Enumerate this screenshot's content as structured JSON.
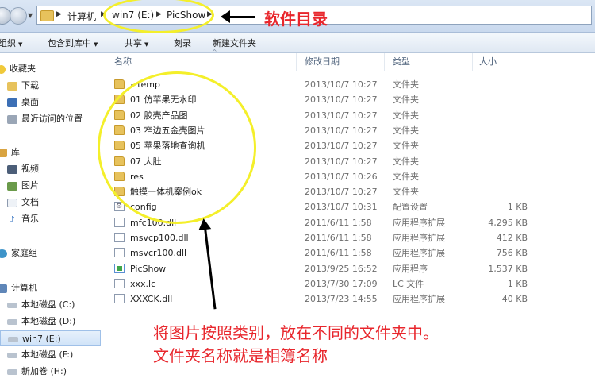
{
  "address": {
    "crumbs": [
      "计算机",
      "win7 (E:)",
      "PicShow"
    ]
  },
  "annotations": {
    "title": "软件目录",
    "note_line1": "将图片按照类别，放在不同的文件夹中。",
    "note_line2": "文件夹名称就是相簿名称",
    "highlight_color": "#f4ef2a",
    "text_color": "#e8262c"
  },
  "toolbar": {
    "organize": "组织",
    "include_in_library": "包含到库中",
    "share": "共享",
    "burn": "刻录",
    "new_folder": "新建文件夹"
  },
  "nav": {
    "favorites": "收藏夹",
    "downloads": "下载",
    "desktop": "桌面",
    "recent": "最近访问的位置",
    "libraries": "库",
    "videos": "视频",
    "pictures": "图片",
    "documents": "文档",
    "music": "音乐",
    "homegroup": "家庭组",
    "computer": "计算机",
    "drive_c": "本地磁盘 (C:)",
    "drive_d": "本地磁盘 (D:)",
    "drive_e": "win7 (E:)",
    "drive_f": "本地磁盘 (F:)",
    "drive_h": "新加卷 (H:)"
  },
  "columns": {
    "name": "名称",
    "modified": "修改日期",
    "type": "类型",
    "size": "大小"
  },
  "files": [
    {
      "name": "~temp",
      "date": "2013/10/7 10:27",
      "type": "文件夹",
      "size": "",
      "icon": "folder"
    },
    {
      "name": "01 仿苹果无水印",
      "date": "2013/10/7 10:27",
      "type": "文件夹",
      "size": "",
      "icon": "folder"
    },
    {
      "name": "02 胶壳产品图",
      "date": "2013/10/7 10:27",
      "type": "文件夹",
      "size": "",
      "icon": "folder"
    },
    {
      "name": "03 窄边五金壳图片",
      "date": "2013/10/7 10:27",
      "type": "文件夹",
      "size": "",
      "icon": "folder"
    },
    {
      "name": "05 苹果落地查询机",
      "date": "2013/10/7 10:27",
      "type": "文件夹",
      "size": "",
      "icon": "folder"
    },
    {
      "name": "07 大肚",
      "date": "2013/10/7 10:27",
      "type": "文件夹",
      "size": "",
      "icon": "folder"
    },
    {
      "name": "res",
      "date": "2013/10/7 10:26",
      "type": "文件夹",
      "size": "",
      "icon": "folder"
    },
    {
      "name": "触摸一体机案例ok",
      "date": "2013/10/7 10:27",
      "type": "文件夹",
      "size": "",
      "icon": "folder"
    },
    {
      "name": "config",
      "date": "2013/10/7 10:31",
      "type": "配置设置",
      "size": "1 KB",
      "icon": "gear"
    },
    {
      "name": "mfc100.dll",
      "date": "2011/6/11 1:58",
      "type": "应用程序扩展",
      "size": "4,295 KB",
      "icon": "file"
    },
    {
      "name": "msvcp100.dll",
      "date": "2011/6/11 1:58",
      "type": "应用程序扩展",
      "size": "412 KB",
      "icon": "file"
    },
    {
      "name": "msvcr100.dll",
      "date": "2011/6/11 1:58",
      "type": "应用程序扩展",
      "size": "756 KB",
      "icon": "file"
    },
    {
      "name": "PicShow",
      "date": "2013/9/25 16:52",
      "type": "应用程序",
      "size": "1,537 KB",
      "icon": "app"
    },
    {
      "name": "xxx.lc",
      "date": "2013/7/30 17:09",
      "type": "LC 文件",
      "size": "1 KB",
      "icon": "file"
    },
    {
      "name": "XXXCK.dll",
      "date": "2013/7/23 14:55",
      "type": "应用程序扩展",
      "size": "40 KB",
      "icon": "file"
    }
  ]
}
